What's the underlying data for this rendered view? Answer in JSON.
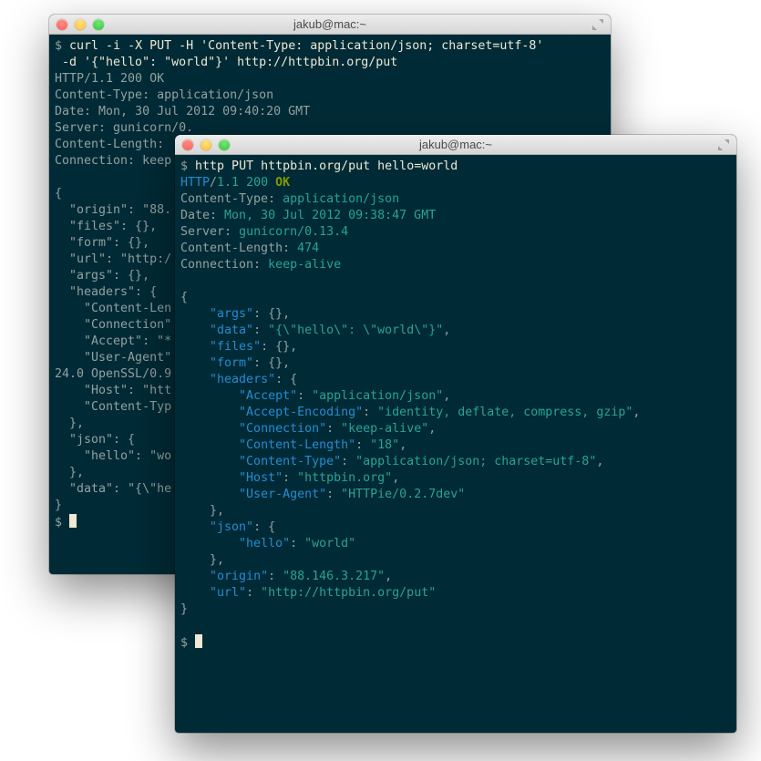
{
  "back": {
    "title": "jakub@mac:~",
    "prompt": "$",
    "cmd_l1": "curl -i -X PUT -H 'Content-Type: application/json; charset=utf-8'",
    "cmd_l2": " -d '{\"hello\": \"world\"}' http://httpbin.org/put",
    "status": "HTTP/1.1 200 OK",
    "h_ct_k": "Content-Type:",
    "h_ct_v": " application/json",
    "h_date_k": "Date:",
    "h_date_v": " Mon, 30 Jul 2012 09:40:20 GMT",
    "h_srv_k": "Server:",
    "h_srv_v": " gunicorn/0.",
    "h_cl_k": "Content-Length:",
    "h_conn_k": "Connection:",
    "h_conn_v": " keep",
    "b01": "{",
    "b02": "  \"origin\": \"88.",
    "b03": "  \"files\": {},",
    "b04": "  \"form\": {},",
    "b05": "  \"url\": \"http:/",
    "b06": "  \"args\": {},",
    "b07": "  \"headers\": {",
    "b08": "    \"Content-Len",
    "b09": "    \"Connection\"",
    "b10": "    \"Accept\": \"*",
    "b11": "    \"User-Agent\"",
    "b12": "24.0 OpenSSL/0.9",
    "b13": "    \"Host\": \"htt",
    "b14": "    \"Content-Typ",
    "b15": "  },",
    "b16": "  \"json\": {",
    "b17": "    \"hello\": \"wo",
    "b18": "  },",
    "b19": "  \"data\": \"{\\\"he",
    "b20": "}"
  },
  "front": {
    "title": "jakub@mac:~",
    "prompt": "$",
    "cmd": "http PUT httpbin.org/put hello=world",
    "st_proto": "HTTP",
    "st_slash": "/",
    "st_ver": "1.1",
    "st_code": "200",
    "st_msg": "OK",
    "h_ct_k": "Content-Type:",
    "h_ct_v": "application/json",
    "h_date_k": "Date:",
    "h_date_v": "Mon, 30 Jul 2012 09:38:47 GMT",
    "h_srv_k": "Server:",
    "h_srv_v": "gunicorn/0.13.4",
    "h_cl_k": "Content-Length:",
    "h_cl_v": "474",
    "h_conn_k": "Connection:",
    "h_conn_v": "keep-alive",
    "j_open": "{",
    "j_args_k": "\"args\"",
    "j_args_v": "{}",
    "j_data_k": "\"data\"",
    "j_data_v": "\"{\\\"hello\\\": \\\"world\\\"}\"",
    "j_files_k": "\"files\"",
    "j_files_v": "{}",
    "j_form_k": "\"form\"",
    "j_form_v": "{}",
    "j_headers_k": "\"headers\"",
    "j_accept_k": "\"Accept\"",
    "j_accept_v": "\"application/json\"",
    "j_ae_k": "\"Accept-Encoding\"",
    "j_ae_v": "\"identity, deflate, compress, gzip\"",
    "j_conn_k": "\"Connection\"",
    "j_conn_v": "\"keep-alive\"",
    "j_cl_k": "\"Content-Length\"",
    "j_cl_v": "\"18\"",
    "j_ct_k": "\"Content-Type\"",
    "j_ct_v": "\"application/json; charset=utf-8\"",
    "j_host_k": "\"Host\"",
    "j_host_v": "\"httpbin.org\"",
    "j_ua_k": "\"User-Agent\"",
    "j_ua_v": "\"HTTPie/0.2.7dev\"",
    "j_json_k": "\"json\"",
    "j_hello_k": "\"hello\"",
    "j_hello_v": "\"world\"",
    "j_origin_k": "\"origin\"",
    "j_origin_v": "\"88.146.3.217\"",
    "j_url_k": "\"url\"",
    "j_url_v": "\"http://httpbin.org/put\"",
    "j_close": "}",
    "colon": ": ",
    "comma": ",",
    "brace_open": " {",
    "brace_close": "    },",
    "indent1": "    ",
    "indent2": "        "
  }
}
